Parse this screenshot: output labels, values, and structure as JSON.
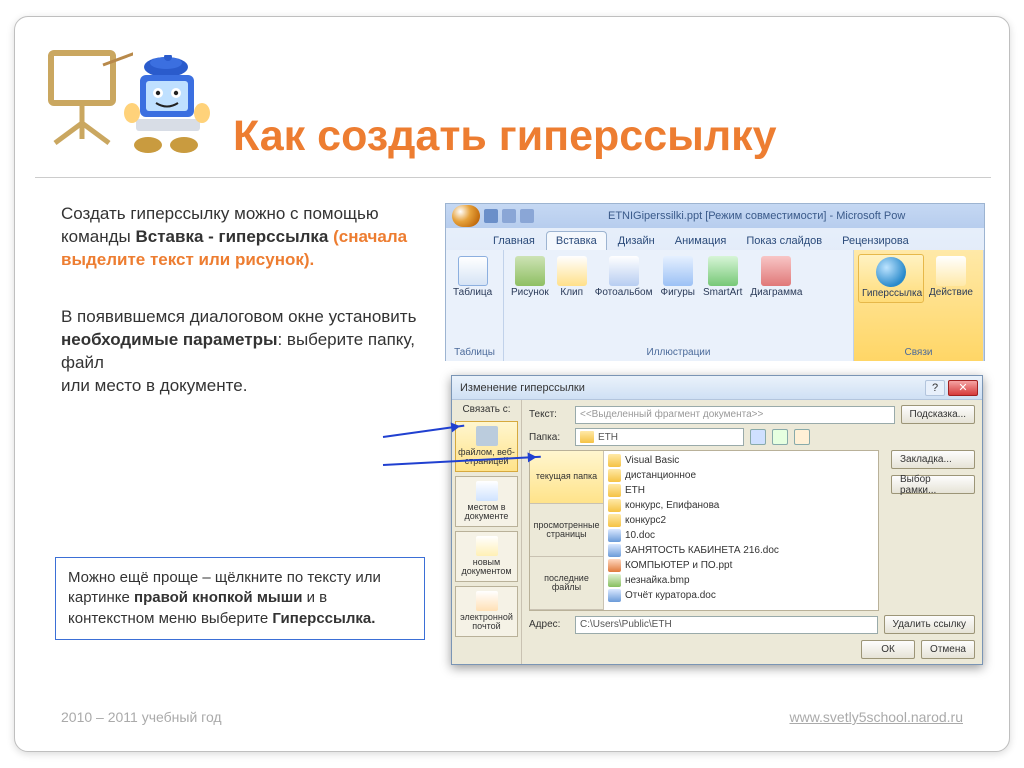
{
  "title": "Как создать гиперссылку",
  "body": {
    "p1_a": "Создать гиперссылку можно с помощью команды ",
    "p1_b": "Вставка  - гиперссылка",
    "p1_c": " (сначала выделите текст или рисунок).",
    "p2_a": "В появившемся диалоговом окне установить ",
    "p2_b": "необходимые параметры",
    "p2_c": ": выберите папку, файл",
    "p2_d": "или место в документе."
  },
  "note": {
    "a": "Можно ещё проще – щёлкните по тексту или картинке ",
    "b": "правой кнопкой мыши",
    "c": " и в контекстном меню выберите ",
    "d": "Гиперссылка."
  },
  "footer": {
    "year": "2010 – 2011 учебный год",
    "url": "www.svetly5school.narod.ru"
  },
  "ribbon": {
    "window_title": "ETNIGiperssilki.ppt [Режим совместимости] - Microsoft Pow",
    "tabs": [
      "Главная",
      "Вставка",
      "Дизайн",
      "Анимация",
      "Показ слайдов",
      "Рецензирова"
    ],
    "active_tab": 1,
    "groups": {
      "tables": {
        "name": "Таблицы",
        "items": [
          "Таблица"
        ]
      },
      "illus": {
        "name": "Иллюстрации",
        "items": [
          "Рисунок",
          "Клип",
          "Фотоальбом",
          "Фигуры",
          "SmartArt",
          "Диаграмма"
        ]
      },
      "links": {
        "name": "Связи",
        "items": [
          "Гиперссылка",
          "Действие"
        ]
      }
    }
  },
  "dialog": {
    "title": "Изменение гиперссылки",
    "link_to_label": "Связать с:",
    "link_to": [
      "файлом, веб-страницей",
      "местом в документе",
      "новым документом",
      "электронной почтой"
    ],
    "text_label": "Текст:",
    "text_value": "<<Выделенный фрагмент документа>>",
    "tip_btn": "Подсказка...",
    "folder_label": "Папка:",
    "folder_value": "ETH",
    "look_in": [
      "текущая папка",
      "просмотренные страницы",
      "последние файлы"
    ],
    "files": [
      {
        "ico": "fold",
        "name": "Visual Basic"
      },
      {
        "ico": "fold",
        "name": "дистанционное"
      },
      {
        "ico": "fold",
        "name": "ETH"
      },
      {
        "ico": "fold",
        "name": "конкурс, Епифанова"
      },
      {
        "ico": "fold",
        "name": "конкурс2"
      },
      {
        "ico": "doc",
        "name": "10.doc"
      },
      {
        "ico": "doc",
        "name": "ЗАНЯТОСТЬ КАБИНЕТА   216.doc"
      },
      {
        "ico": "ppt",
        "name": "КОМПЬЮТЕР и ПО.ppt"
      },
      {
        "ico": "bmp",
        "name": "незнайка.bmp"
      },
      {
        "ico": "doc",
        "name": "Отчёт куратора.doc"
      }
    ],
    "bookmark_btn": "Закладка...",
    "frame_btn": "Выбор рамки...",
    "addr_label": "Адрес:",
    "addr_value": "C:\\Users\\Public\\ETH",
    "remove_btn": "Удалить ссылку",
    "ok": "ОК",
    "cancel": "Отмена"
  }
}
